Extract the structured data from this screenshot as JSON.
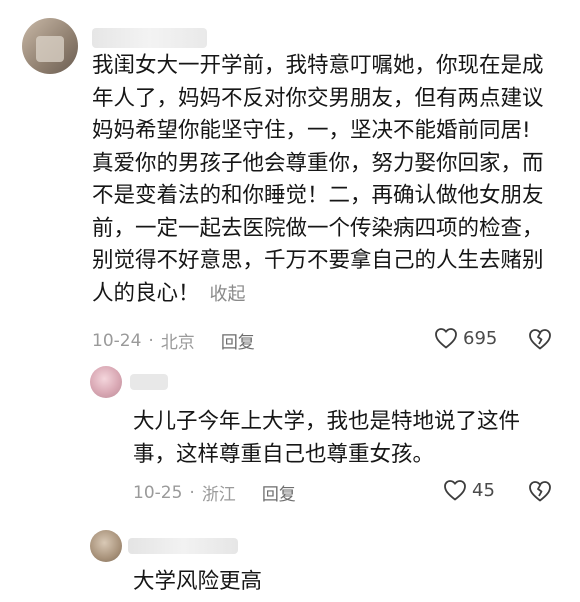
{
  "comments": [
    {
      "lines": [
        "我闺女大一开学前，我特意叮嘱她，你现在是成",
        "年人了，妈妈不反对你交男朋友，但有两点建议",
        "妈妈希望你能坚守住，一，坚决不能婚前同居!",
        "真爱你的男孩子他会尊重你，努力娶你回家，而",
        "不是变着法的和你睡觉！二，再确认做他女朋友",
        "前，一定一起去医院做一个传染病四项的检查，",
        "别觉得不好意思，千万不要拿自己的人生去赌别",
        "人的良心！"
      ],
      "collapse_label": "收起",
      "date": "10-24",
      "location": "北京",
      "reply_label": "回复",
      "likes": "695"
    },
    {
      "lines": [
        "大儿子今年上大学，我也是特地说了这件",
        "事，这样尊重自己也尊重女孩。"
      ],
      "date": "10-25",
      "location": "浙江",
      "reply_label": "回复",
      "likes": "45"
    },
    {
      "lines": [
        "大学风险更高"
      ]
    }
  ],
  "separator": "·",
  "icons": {
    "like": "heart-outline-icon",
    "dislike": "broken-heart-icon"
  }
}
